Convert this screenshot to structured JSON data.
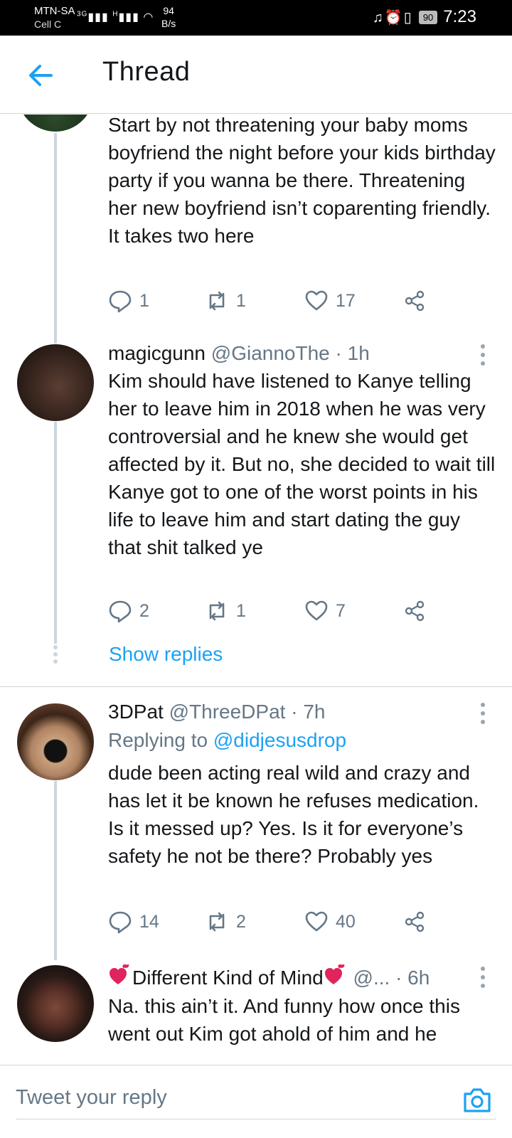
{
  "status_bar": {
    "carrier": "MTN-SA",
    "carrier2": "Cell C",
    "net1": "3G",
    "net2": "H",
    "speed_value": "94",
    "speed_unit": "B/s",
    "battery": "90",
    "time": "7:23"
  },
  "header": {
    "title": "Thread"
  },
  "tweets": [
    {
      "text": "Start by not threatening your baby moms boyfriend the night before your kids birthday party if you wanna be there.  Threatening her new boyfriend isn’t coparenting friendly. It takes two here",
      "replies": "1",
      "retweets": "1",
      "likes": "17"
    },
    {
      "name": "magicgunn",
      "handle": "@GiannoThe",
      "time": "· 1h",
      "text": "Kim should have listened to Kanye telling her to leave him in 2018 when he was very controversial and he knew she would get affected by it. But no, she decided to wait till Kanye got to one of the worst points in his life to leave him and start dating the guy that shit talked ye",
      "replies": "2",
      "retweets": "1",
      "likes": "7",
      "show_replies": "Show replies"
    },
    {
      "name": "3DPat",
      "handle": "@ThreeDPat",
      "time": "· 7h",
      "replying_prefix": "Replying to",
      "replying_handle": "@didjesusdrop",
      "text": "dude been acting real wild and crazy and has let it be known he refuses medication. Is it messed up? Yes. Is it for everyone’s safety he not be there? Probably yes",
      "replies": "14",
      "retweets": "2",
      "likes": "40"
    },
    {
      "name": "Different Kind of Mind",
      "handle": "@...",
      "time": "· 6h",
      "text": "Na. this ain’t it. And funny how once this went out Kim got ahold of him and he"
    }
  ],
  "compose": {
    "placeholder": "Tweet your reply"
  },
  "colors": {
    "accent": "#1da1f2",
    "secondary_text": "#657786",
    "thread_line": "#ccd6dd",
    "heart_emoji": "#e0245e"
  },
  "icons": {
    "back": "arrow-left-icon",
    "reply": "comment-icon",
    "retweet": "retweet-icon",
    "like": "heart-icon",
    "share": "share-icon",
    "more": "more-vertical-icon",
    "camera": "camera-icon"
  }
}
